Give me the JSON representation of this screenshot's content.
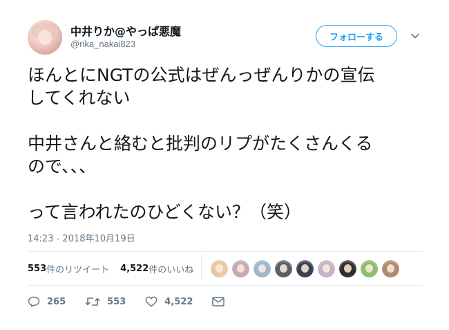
{
  "user": {
    "display_name": "中井りか@やっぱ悪魔",
    "handle": "@rika_nakai823",
    "avatar": "profile-photo"
  },
  "follow_button": {
    "label": "フォローする"
  },
  "more_menu": {
    "icon": "chevron-down-icon"
  },
  "tweet": {
    "text": "ほんとにNGTの公式はぜんっぜんりかの宣伝\nしてくれない\n\n中井さんと絡むと批判のリプがたくさんくる\nので、、、\n\nって言われたのひどくない？（笑）",
    "timestamp": "14:23 - 2018年10月19日"
  },
  "stats": {
    "retweets_count": "553",
    "retweets_label": "件のリツイート",
    "likes_count": "4,522",
    "likes_label": "件のいいね"
  },
  "likers": [
    {
      "color": "#e8c9a6"
    },
    {
      "color": "#c9a9b0"
    },
    {
      "color": "#9eb7cf"
    },
    {
      "color": "#5a5f66"
    },
    {
      "color": "#3a3e52"
    },
    {
      "color": "#c7b3c9"
    },
    {
      "color": "#2f2f2f"
    },
    {
      "color": "#8bbf6e"
    },
    {
      "color": "#b08a6b"
    }
  ],
  "actions": {
    "reply_count": "265",
    "retweet_count": "553",
    "like_count": "4,522"
  },
  "colors": {
    "accent": "#1da1f2",
    "muted_text": "#657786",
    "divider": "#e6ecf0"
  }
}
